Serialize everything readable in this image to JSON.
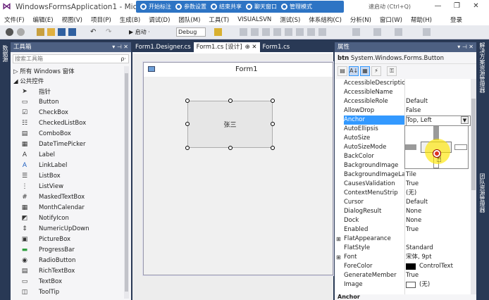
{
  "window": {
    "title": "WindowsFormsApplication1 - Mic",
    "quick_launch": "速启动 (Ctrl+Q)",
    "login": "登录",
    "minimize": "—",
    "restore": "❐",
    "close": "✕"
  },
  "overlay_toolbar": {
    "items": [
      "开始标注",
      "参数设置",
      "结束共享",
      "聊天窗口",
      "管理模式"
    ]
  },
  "menu": [
    "文件(F)",
    "编辑(E)",
    "视图(V)",
    "项目(P)",
    "生成(B)",
    "调试(D)",
    "团队(M)",
    "工具(T)",
    "VISUALSVN",
    "测试(S)",
    "体系结构(C)",
    "分析(N)",
    "窗口(W)",
    "帮助(H)"
  ],
  "toolbar": {
    "start_label": "▶ 启动 ·",
    "config": "Debug"
  },
  "left_strip": {
    "label": "数据源"
  },
  "right_strip": {
    "labels": [
      "解决方案资源管理器",
      "团队资源管理器"
    ]
  },
  "toolbox": {
    "title": "工具箱",
    "pin": "▾ ⊣ ✕",
    "search_placeholder": "搜索工具箱",
    "search_icon": "ρ·",
    "category_all": "▷ 所有 Windows 窗体",
    "category_common": "◢ 公共控件",
    "items": [
      {
        "icon": "pointer-icon",
        "glyph": "➤",
        "label": "指针"
      },
      {
        "icon": "button-icon",
        "glyph": "▭",
        "label": "Button"
      },
      {
        "icon": "checkbox-icon",
        "glyph": "☑",
        "label": "CheckBox"
      },
      {
        "icon": "checkedlistbox-icon",
        "glyph": "☷",
        "label": "CheckedListBox"
      },
      {
        "icon": "combobox-icon",
        "glyph": "▤",
        "label": "ComboBox"
      },
      {
        "icon": "datetimepicker-icon",
        "glyph": "▦",
        "label": "DateTimePicker"
      },
      {
        "icon": "label-icon",
        "glyph": "A",
        "label": "Label"
      },
      {
        "icon": "linklabel-icon",
        "glyph": "A",
        "label": "LinkLabel"
      },
      {
        "icon": "listbox-icon",
        "glyph": "☰",
        "label": "ListBox"
      },
      {
        "icon": "listview-icon",
        "glyph": "⋮",
        "label": "ListView"
      },
      {
        "icon": "maskedtextbox-icon",
        "glyph": "#",
        "label": "MaskedTextBox"
      },
      {
        "icon": "monthcalendar-icon",
        "glyph": "▦",
        "label": "MonthCalendar"
      },
      {
        "icon": "notifyicon-icon",
        "glyph": "◩",
        "label": "NotifyIcon"
      },
      {
        "icon": "numericupdown-icon",
        "glyph": "⇕",
        "label": "NumericUpDown"
      },
      {
        "icon": "picturebox-icon",
        "glyph": "▣",
        "label": "PictureBox"
      },
      {
        "icon": "progressbar-icon",
        "glyph": "▬",
        "label": "ProgressBar"
      },
      {
        "icon": "radiobutton-icon",
        "glyph": "◉",
        "label": "RadioButton"
      },
      {
        "icon": "richtextbox-icon",
        "glyph": "▤",
        "label": "RichTextBox"
      },
      {
        "icon": "textbox-icon",
        "glyph": "▭",
        "label": "TextBox"
      },
      {
        "icon": "tooltip-icon",
        "glyph": "◫",
        "label": "ToolTip"
      }
    ]
  },
  "designer": {
    "tabs": [
      {
        "label": "Form1.Designer.cs",
        "active": false
      },
      {
        "label": "Form1.cs [设计]",
        "active": true
      },
      {
        "label": "⊕ ✕",
        "active": true
      },
      {
        "label": "Form1.cs",
        "active": false
      }
    ],
    "form_title": "Form1",
    "button_text": "张三"
  },
  "properties": {
    "title": "属性",
    "pin": "▾ ⊣ ✕",
    "object_name": "btn",
    "object_type": "System.Windows.Forms.Button",
    "rows": [
      {
        "name": "AccessibleDescriptio",
        "value": ""
      },
      {
        "name": "AccessibleName",
        "value": ""
      },
      {
        "name": "AccessibleRole",
        "value": "Default"
      },
      {
        "name": "AllowDrop",
        "value": "False"
      },
      {
        "name": "Anchor",
        "value": "Top, Left"
      },
      {
        "name": "AutoEllipsis",
        "value": ""
      },
      {
        "name": "AutoSize",
        "value": ""
      },
      {
        "name": "AutoSizeMode",
        "value": ""
      },
      {
        "name": "BackColor",
        "value": ""
      },
      {
        "name": "BackgroundImage",
        "value": ""
      },
      {
        "name": "BackgroundImageLay",
        "value": "Tile"
      },
      {
        "name": "CausesValidation",
        "value": "True"
      },
      {
        "name": "ContextMenuStrip",
        "value": "(无)"
      },
      {
        "name": "Cursor",
        "value": "Default"
      },
      {
        "name": "DialogResult",
        "value": "None"
      },
      {
        "name": "Dock",
        "value": "None"
      },
      {
        "name": "Enabled",
        "value": "True"
      },
      {
        "name": "FlatAppearance",
        "value": "",
        "expand": "⊞"
      },
      {
        "name": "FlatStyle",
        "value": "Standard"
      },
      {
        "name": "Font",
        "value": "宋体, 9pt",
        "expand": "⊞"
      },
      {
        "name": "ForeColor",
        "value": "ControlText"
      },
      {
        "name": "GenerateMember",
        "value": "True"
      },
      {
        "name": "Image",
        "value": "(无)"
      }
    ],
    "description_title": "Anchor"
  },
  "colors": {
    "accent": "#3399ff",
    "panel_header": "#4d6082",
    "background": "#293955",
    "overlay": "#2d74c4"
  }
}
